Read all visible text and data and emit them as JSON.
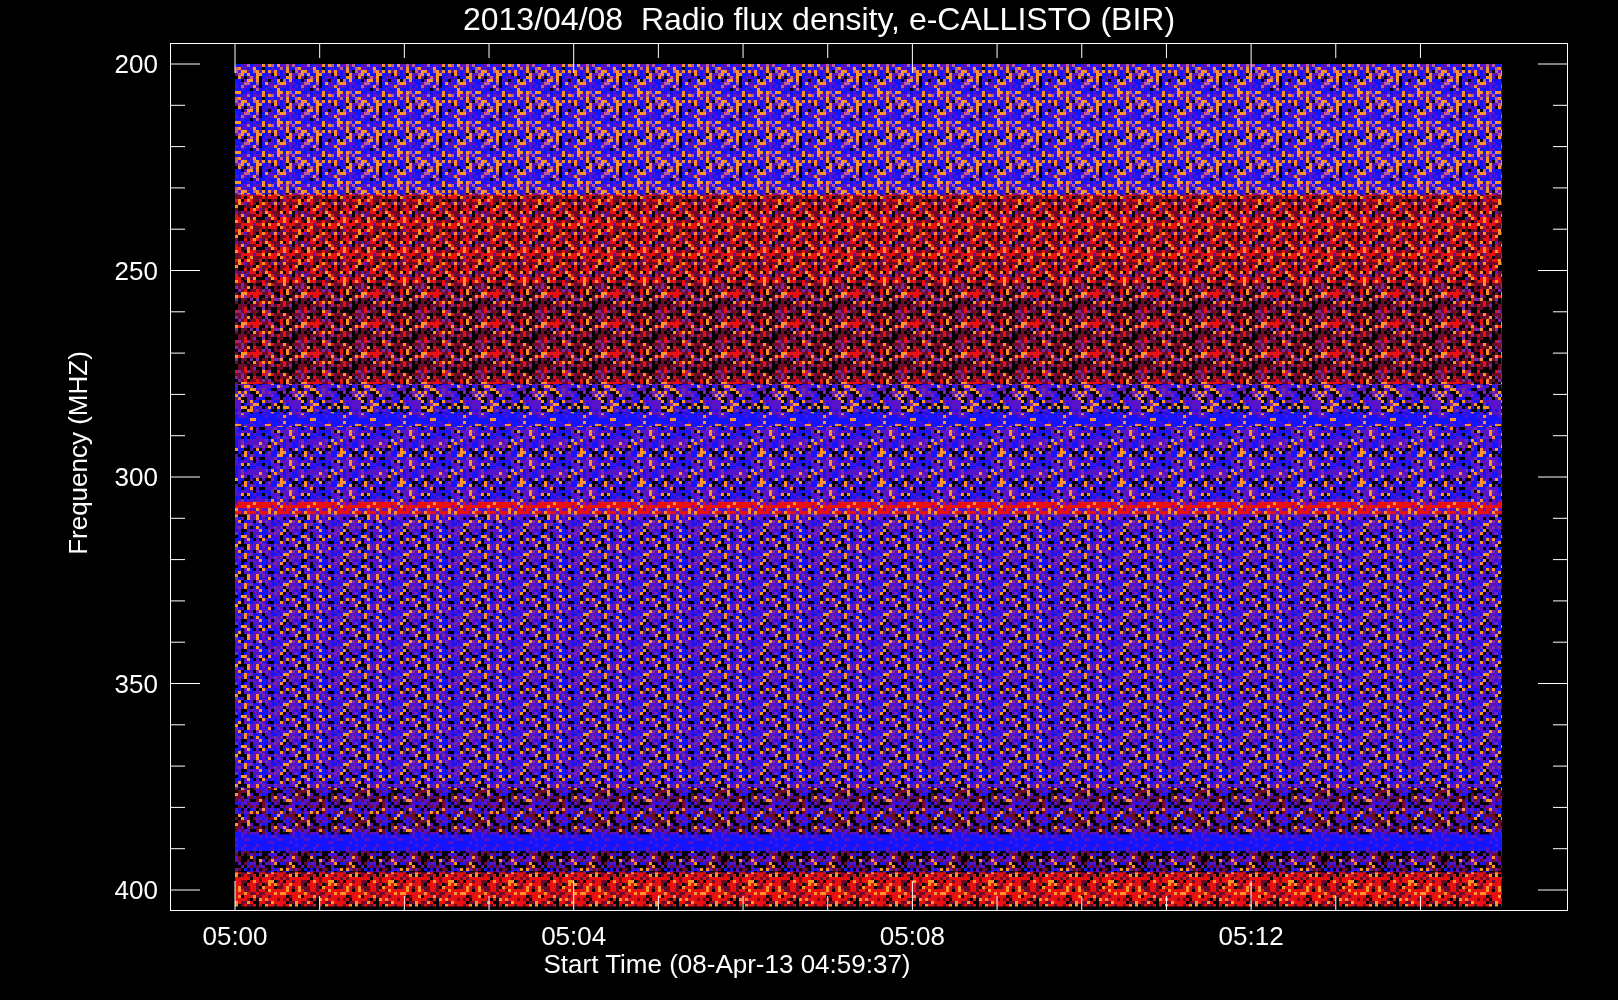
{
  "plot": {
    "title": "2013/04/08  Radio flux density, e-CALLISTO (BIR)",
    "y_axis": {
      "label": "Frequency (MHZ)",
      "ticks": [
        "200",
        "250",
        "300",
        "350",
        "400"
      ]
    },
    "x_axis": {
      "label": "Start Time (08-Apr-13 04:59:37)",
      "ticks": [
        "05:00",
        "05:04",
        "05:08",
        "05:12"
      ]
    }
  }
}
